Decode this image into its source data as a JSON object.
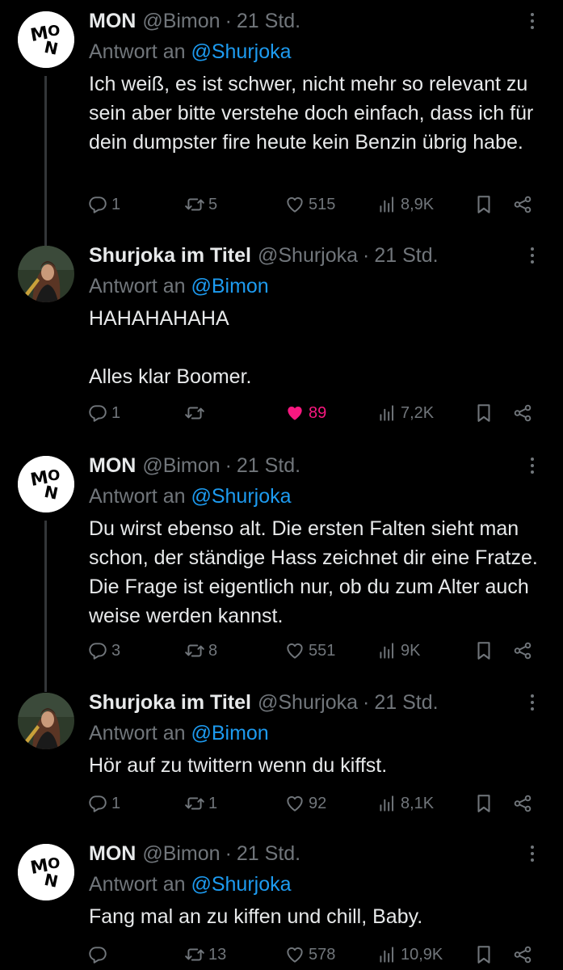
{
  "tweets": [
    {
      "author": "MON",
      "handle": "@Bimon",
      "time": "21 Std.",
      "reply_label": "Antwort an",
      "reply_to": "@Shurjoka",
      "text": "Ich weiß, es ist schwer, nicht mehr so relevant zu sein aber bitte verstehe doch einfach, dass ich für dein dumpster fire heute kein Benzin übrig habe.",
      "replies": "1",
      "retweets": "5",
      "likes": "515",
      "views": "8,9K",
      "liked": false
    },
    {
      "author": "Shurjoka im Titel",
      "handle": "@Shurjoka",
      "time": "21 Std.",
      "reply_label": "Antwort an",
      "reply_to": "@Bimon",
      "text": "HAHAHAHAHA\n\nAlles klar Boomer.",
      "replies": "1",
      "retweets": "",
      "likes": "89",
      "views": "7,2K",
      "liked": true
    },
    {
      "author": "MON",
      "handle": "@Bimon",
      "time": "21 Std.",
      "reply_label": "Antwort an",
      "reply_to": "@Shurjoka",
      "text": "Du wirst ebenso alt. Die ersten Falten sieht man schon, der ständige Hass zeichnet dir eine Fratze. Die Frage ist eigentlich nur, ob du zum Alter auch weise werden kannst.",
      "replies": "3",
      "retweets": "8",
      "likes": "551",
      "views": "9K",
      "liked": false
    },
    {
      "author": "Shurjoka im Titel",
      "handle": "@Shurjoka",
      "time": "21 Std.",
      "reply_label": "Antwort an",
      "reply_to": "@Bimon",
      "text": "Hör auf zu twittern wenn du kiffst.",
      "replies": "1",
      "retweets": "1",
      "likes": "92",
      "views": "8,1K",
      "liked": false
    },
    {
      "author": "MON",
      "handle": "@Bimon",
      "time": "21 Std.",
      "reply_label": "Antwort an",
      "reply_to": "@Shurjoka",
      "text": "Fang mal an zu kiffen und chill, Baby.",
      "replies": "",
      "retweets": "13",
      "likes": "578",
      "views": "10,9K",
      "liked": false
    }
  ],
  "separator": "·",
  "mon_logo_text": "MON",
  "colors": {
    "background": "#000000",
    "text": "#e7e9ea",
    "muted": "#71767b",
    "link": "#1d9bf0",
    "like": "#f91880"
  },
  "icons": [
    "reply-icon",
    "retweet-icon",
    "like-icon",
    "views-icon",
    "bookmark-icon",
    "share-icon",
    "more-icon"
  ]
}
